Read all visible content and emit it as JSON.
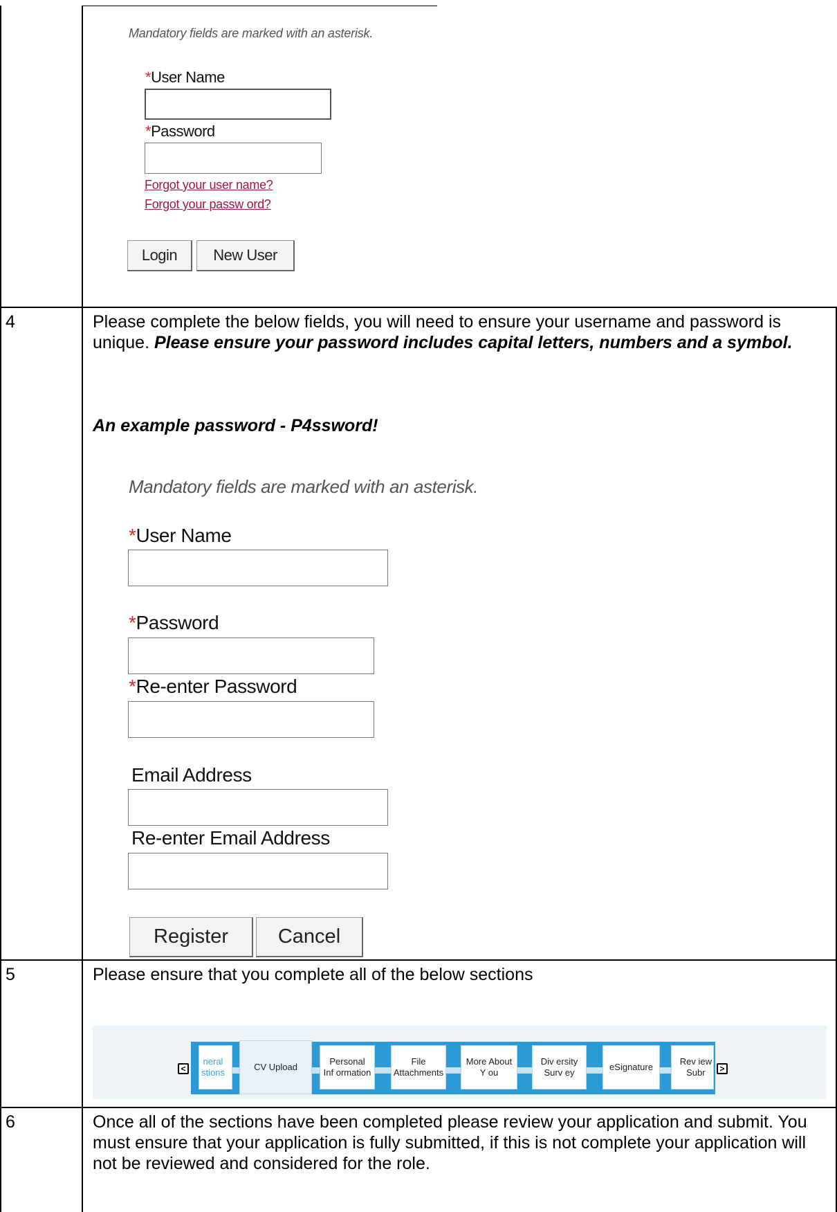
{
  "login_form": {
    "mandatory_note": "Mandatory fields are marked with an asterisk.",
    "asterisk": "*",
    "username_label": "User Name",
    "password_label": "Password",
    "username_value": "",
    "password_value": "",
    "forgot_username": "Forgot your user name?",
    "forgot_password": "Forgot your passw ord?",
    "login_button": "Login",
    "new_user_button": "New User"
  },
  "rows": [
    {
      "number": "4",
      "text": "Please complete the below fields, you will need to ensure your username and password is unique.",
      "emphasis": "Please ensure your password includes capital letters, numbers and a symbol.",
      "example": "An example password -  P4ssword!"
    },
    {
      "number": "5",
      "text": "Please ensure that you complete all of the below sections"
    },
    {
      "number": "6",
      "text": "Once all of the sections have been completed please review your application and submit. You must ensure that your application is fully submitted, if this is not complete your application will not be reviewed and considered for the role."
    }
  ],
  "register_form": {
    "mandatory_note": "Mandatory fields are marked with an asterisk.",
    "asterisk": "*",
    "username_label": "User Name",
    "password_label": "Password",
    "reenter_password_label": "Re-enter Password",
    "email_label": "Email Address",
    "reenter_email_label": "Re-enter Email Address",
    "register_button": "Register",
    "cancel_button": "Cancel"
  },
  "step_bar": {
    "prev_arrow": "<",
    "next_arrow": ">",
    "steps": [
      {
        "label_line1": "neral",
        "label_line2": "stions"
      },
      {
        "label_line1": "CV Upload",
        "label_line2": ""
      },
      {
        "label_line1": "Personal",
        "label_line2": "Inf ormation"
      },
      {
        "label_line1": "File",
        "label_line2": "Attachments"
      },
      {
        "label_line1": "More About",
        "label_line2": "Y ou"
      },
      {
        "label_line1": "Div ersity",
        "label_line2": "Surv ey"
      },
      {
        "label_line1": "eSignature",
        "label_line2": ""
      },
      {
        "label_line1": "Rev iew",
        "label_line2": "Subr"
      }
    ]
  },
  "colors": {
    "asterisk": "#d9262c",
    "link": "#a0174b",
    "step_strip": "#2c9bd5",
    "step_bar_bg": "#eef3f8"
  }
}
